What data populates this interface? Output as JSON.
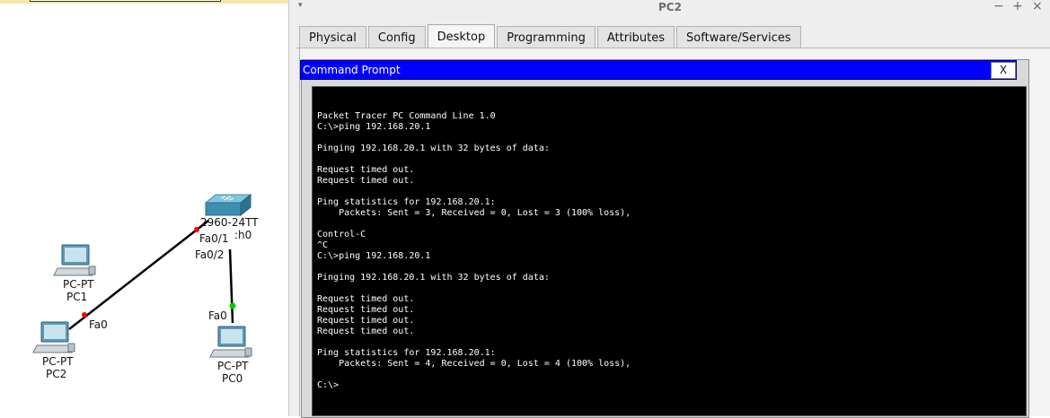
{
  "topology": {
    "switch_label": "2960-24TT",
    "switch_port_partial": ":h0",
    "port_fa0_1": "Fa0/1",
    "port_fa0_2": "Fa0/2",
    "port_fa0_pc2": "Fa0",
    "port_fa0_pc0": "Fa0",
    "pc1": {
      "type": "PC-PT",
      "name": "PC1"
    },
    "pc2": {
      "type": "PC-PT",
      "name": "PC2"
    },
    "pc0": {
      "type": "PC-PT",
      "name": "PC0"
    }
  },
  "window": {
    "title": "PC2",
    "menu_arrow": "▾",
    "minimize": "−",
    "maximize": "+",
    "close": "×"
  },
  "tabs": [
    "Physical",
    "Config",
    "Desktop",
    "Programming",
    "Attributes",
    "Software/Services"
  ],
  "active_tab": "Desktop",
  "command_prompt": {
    "title": "Command Prompt",
    "close_label": "X",
    "lines": [
      "",
      "Packet Tracer PC Command Line 1.0",
      "C:\\>ping 192.168.20.1",
      "",
      "Pinging 192.168.20.1 with 32 bytes of data:",
      "",
      "Request timed out.",
      "Request timed out.",
      "",
      "Ping statistics for 192.168.20.1:",
      "    Packets: Sent = 3, Received = 0, Lost = 3 (100% loss),",
      "",
      "Control-C",
      "^C",
      "C:\\>ping 192.168.20.1",
      "",
      "Pinging 192.168.20.1 with 32 bytes of data:",
      "",
      "Request timed out.",
      "Request timed out.",
      "Request timed out.",
      "Request timed out.",
      "",
      "Ping statistics for 192.168.20.1:",
      "    Packets: Sent = 4, Received = 0, Lost = 4 (100% loss),",
      "",
      "C:\\>"
    ]
  },
  "colors": {
    "cmd_header": "#0000ff",
    "terminal_bg": "#000000",
    "link_down": "#ff0000",
    "link_up": "#00cc00"
  }
}
